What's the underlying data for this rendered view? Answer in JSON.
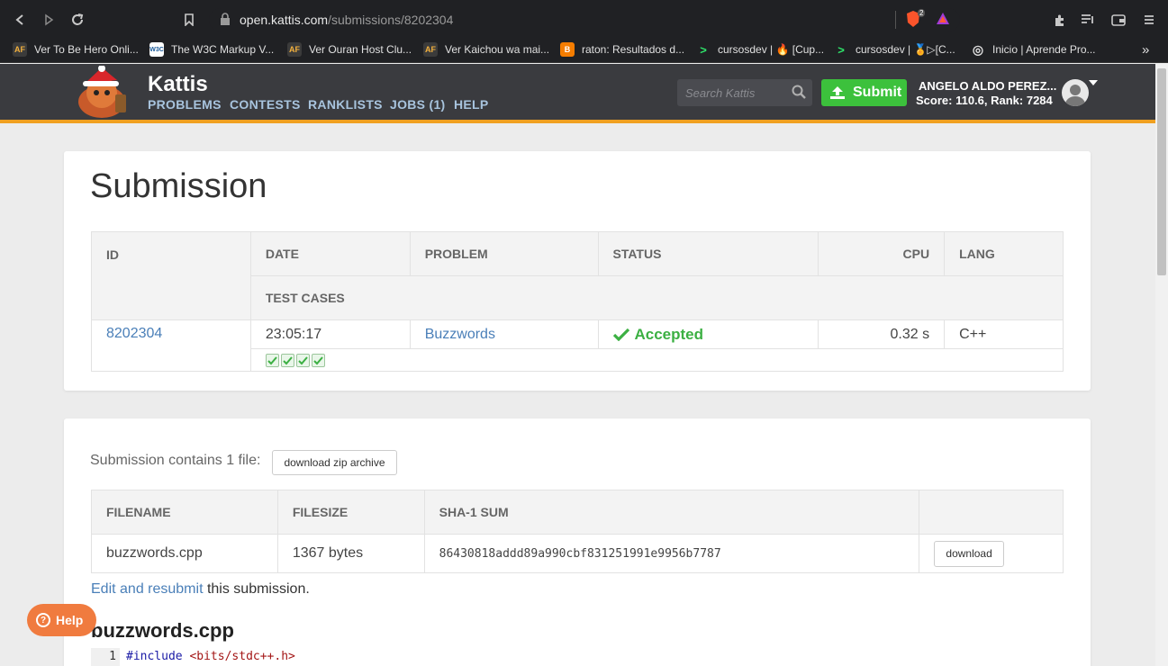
{
  "browser": {
    "url_host": "open.kattis.com",
    "url_path": "/submissions/8202304",
    "brave_badge": "2",
    "bookmarks": [
      {
        "icon_text": "AF",
        "label": "Ver To Be Hero Onli..."
      },
      {
        "icon_text": "W3C",
        "label": "The W3C Markup V..."
      },
      {
        "icon_text": "AF",
        "label": "Ver Ouran Host Clu..."
      },
      {
        "icon_text": "AF",
        "label": "Ver Kaichou wa mai..."
      },
      {
        "icon_text": "B",
        "label": "raton: Resultados d..."
      },
      {
        "icon_text": ">",
        "label": "cursosdev | 🔥 [Cup..."
      },
      {
        "icon_text": ">",
        "label": "cursosdev | 🏅▷[C..."
      },
      {
        "icon_text": "◎",
        "label": "Inicio | Aprende Pro..."
      }
    ],
    "more": "»"
  },
  "header": {
    "brand": "Kattis",
    "nav": [
      "PROBLEMS",
      "CONTESTS",
      "RANKLISTS",
      "JOBS (1)",
      "HELP"
    ],
    "search_placeholder": "Search Kattis",
    "submit_label": "Submit",
    "user_name": "ANGELO ALDO PEREZ...",
    "user_score": "Score: 110.6, Rank: 7284"
  },
  "submission": {
    "title": "Submission",
    "headers": {
      "id": "ID",
      "date": "DATE",
      "problem": "PROBLEM",
      "status": "STATUS",
      "cpu": "CPU",
      "lang": "LANG",
      "test_cases": "TEST CASES"
    },
    "row": {
      "id": "8202304",
      "date": "23:05:17",
      "problem": "Buzzwords",
      "status": "Accepted",
      "cpu": "0.32 s",
      "lang": "C++"
    },
    "test_cases_passed": 4
  },
  "files": {
    "contains_text": "Submission contains 1 file:",
    "zip_button": "download zip archive",
    "headers": {
      "filename": "FILENAME",
      "filesize": "FILESIZE",
      "sha": "SHA-1 SUM"
    },
    "row": {
      "filename": "buzzwords.cpp",
      "filesize": "1367 bytes",
      "sha": "86430818addd89a990cbf831251991e9956b7787",
      "download": "download"
    },
    "resubmit_link": "Edit and resubmit",
    "resubmit_rest": " this submission.",
    "file_title": "buzzwords.cpp",
    "code_line_no": "1",
    "code_kw": "#include",
    "code_str": " <bits/stdc++.h>"
  },
  "help_label": "Help",
  "colors": {
    "accent": "#4a7fb8",
    "success": "#3cb043",
    "submit": "#3cc13c",
    "header_bg": "#3a3b3f",
    "header_stripe": "#f0a020",
    "help": "#f07b3f"
  }
}
